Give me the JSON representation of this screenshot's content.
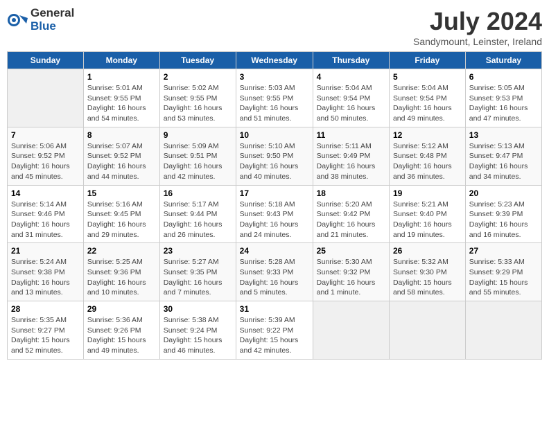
{
  "logo": {
    "general": "General",
    "blue": "Blue"
  },
  "title": {
    "month_year": "July 2024",
    "location": "Sandymount, Leinster, Ireland"
  },
  "days_of_week": [
    "Sunday",
    "Monday",
    "Tuesday",
    "Wednesday",
    "Thursday",
    "Friday",
    "Saturday"
  ],
  "weeks": [
    [
      {
        "day": null
      },
      {
        "day": "1",
        "sunrise": "5:01 AM",
        "sunset": "9:55 PM",
        "daylight": "16 hours and 54 minutes."
      },
      {
        "day": "2",
        "sunrise": "5:02 AM",
        "sunset": "9:55 PM",
        "daylight": "16 hours and 53 minutes."
      },
      {
        "day": "3",
        "sunrise": "5:03 AM",
        "sunset": "9:55 PM",
        "daylight": "16 hours and 51 minutes."
      },
      {
        "day": "4",
        "sunrise": "5:04 AM",
        "sunset": "9:54 PM",
        "daylight": "16 hours and 50 minutes."
      },
      {
        "day": "5",
        "sunrise": "5:04 AM",
        "sunset": "9:54 PM",
        "daylight": "16 hours and 49 minutes."
      },
      {
        "day": "6",
        "sunrise": "5:05 AM",
        "sunset": "9:53 PM",
        "daylight": "16 hours and 47 minutes."
      }
    ],
    [
      {
        "day": "7",
        "sunrise": "5:06 AM",
        "sunset": "9:52 PM",
        "daylight": "16 hours and 45 minutes."
      },
      {
        "day": "8",
        "sunrise": "5:07 AM",
        "sunset": "9:52 PM",
        "daylight": "16 hours and 44 minutes."
      },
      {
        "day": "9",
        "sunrise": "5:09 AM",
        "sunset": "9:51 PM",
        "daylight": "16 hours and 42 minutes."
      },
      {
        "day": "10",
        "sunrise": "5:10 AM",
        "sunset": "9:50 PM",
        "daylight": "16 hours and 40 minutes."
      },
      {
        "day": "11",
        "sunrise": "5:11 AM",
        "sunset": "9:49 PM",
        "daylight": "16 hours and 38 minutes."
      },
      {
        "day": "12",
        "sunrise": "5:12 AM",
        "sunset": "9:48 PM",
        "daylight": "16 hours and 36 minutes."
      },
      {
        "day": "13",
        "sunrise": "5:13 AM",
        "sunset": "9:47 PM",
        "daylight": "16 hours and 34 minutes."
      }
    ],
    [
      {
        "day": "14",
        "sunrise": "5:14 AM",
        "sunset": "9:46 PM",
        "daylight": "16 hours and 31 minutes."
      },
      {
        "day": "15",
        "sunrise": "5:16 AM",
        "sunset": "9:45 PM",
        "daylight": "16 hours and 29 minutes."
      },
      {
        "day": "16",
        "sunrise": "5:17 AM",
        "sunset": "9:44 PM",
        "daylight": "16 hours and 26 minutes."
      },
      {
        "day": "17",
        "sunrise": "5:18 AM",
        "sunset": "9:43 PM",
        "daylight": "16 hours and 24 minutes."
      },
      {
        "day": "18",
        "sunrise": "5:20 AM",
        "sunset": "9:42 PM",
        "daylight": "16 hours and 21 minutes."
      },
      {
        "day": "19",
        "sunrise": "5:21 AM",
        "sunset": "9:40 PM",
        "daylight": "16 hours and 19 minutes."
      },
      {
        "day": "20",
        "sunrise": "5:23 AM",
        "sunset": "9:39 PM",
        "daylight": "16 hours and 16 minutes."
      }
    ],
    [
      {
        "day": "21",
        "sunrise": "5:24 AM",
        "sunset": "9:38 PM",
        "daylight": "16 hours and 13 minutes."
      },
      {
        "day": "22",
        "sunrise": "5:25 AM",
        "sunset": "9:36 PM",
        "daylight": "16 hours and 10 minutes."
      },
      {
        "day": "23",
        "sunrise": "5:27 AM",
        "sunset": "9:35 PM",
        "daylight": "16 hours and 7 minutes."
      },
      {
        "day": "24",
        "sunrise": "5:28 AM",
        "sunset": "9:33 PM",
        "daylight": "16 hours and 5 minutes."
      },
      {
        "day": "25",
        "sunrise": "5:30 AM",
        "sunset": "9:32 PM",
        "daylight": "16 hours and 1 minute."
      },
      {
        "day": "26",
        "sunrise": "5:32 AM",
        "sunset": "9:30 PM",
        "daylight": "15 hours and 58 minutes."
      },
      {
        "day": "27",
        "sunrise": "5:33 AM",
        "sunset": "9:29 PM",
        "daylight": "15 hours and 55 minutes."
      }
    ],
    [
      {
        "day": "28",
        "sunrise": "5:35 AM",
        "sunset": "9:27 PM",
        "daylight": "15 hours and 52 minutes."
      },
      {
        "day": "29",
        "sunrise": "5:36 AM",
        "sunset": "9:26 PM",
        "daylight": "15 hours and 49 minutes."
      },
      {
        "day": "30",
        "sunrise": "5:38 AM",
        "sunset": "9:24 PM",
        "daylight": "15 hours and 46 minutes."
      },
      {
        "day": "31",
        "sunrise": "5:39 AM",
        "sunset": "9:22 PM",
        "daylight": "15 hours and 42 minutes."
      },
      {
        "day": null
      },
      {
        "day": null
      },
      {
        "day": null
      }
    ]
  ]
}
